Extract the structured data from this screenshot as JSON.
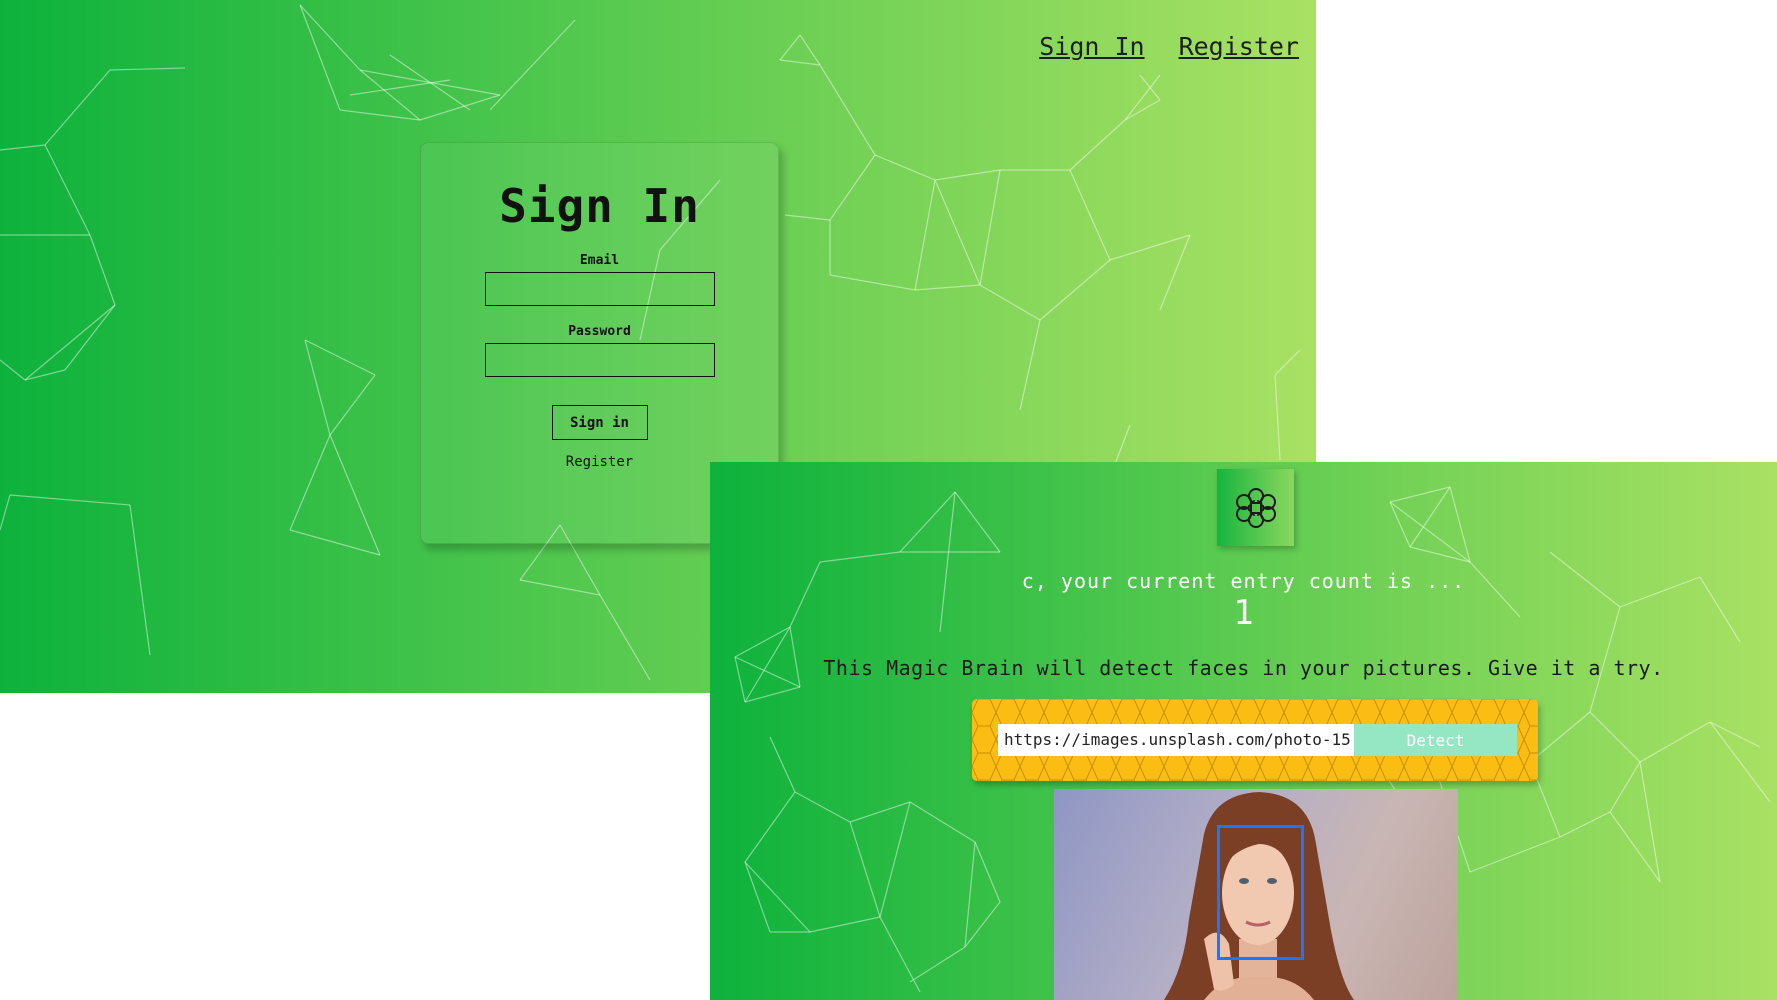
{
  "signin_page": {
    "nav": {
      "signin": "Sign In",
      "register": "Register"
    },
    "form": {
      "title": "Sign In",
      "email_label": "Email",
      "email_value": "",
      "password_label": "Password",
      "password_value": "",
      "submit_label": "Sign in",
      "register_link": "Register"
    }
  },
  "app_page": {
    "logo_icon": "brain-icon",
    "entry_text": "c, your current entry count is ...",
    "entry_count": "1",
    "description": "This Magic Brain will detect faces in your pictures. Give it a try.",
    "url_input_value": "https://images.unsplash.com/photo-15",
    "detect_label": "Detect",
    "face_box_color": "#1976ff"
  },
  "colors": {
    "gradient_start": "#0db23c",
    "gradient_end": "#a9e163",
    "form_background": "#fbbd14",
    "detect_button": "#95e6c2"
  }
}
